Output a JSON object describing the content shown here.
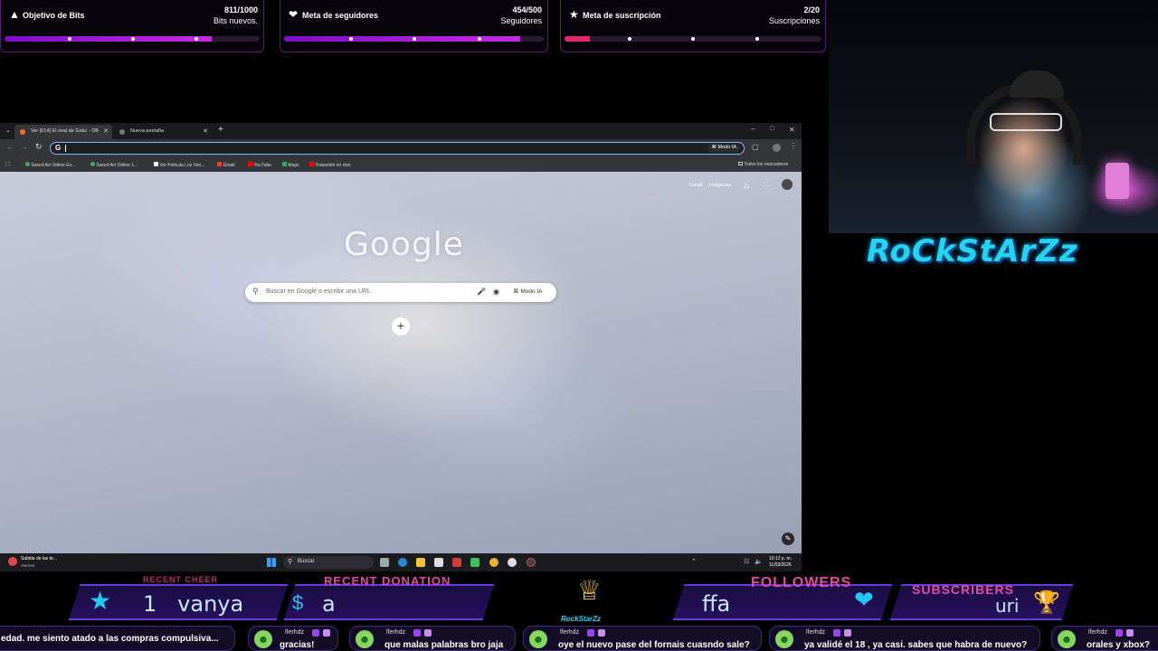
{
  "goals": {
    "bits": {
      "title": "Objetivo de Bits",
      "count": "811/1000",
      "sub": "Bits nuevos.",
      "icon": "bits-icon",
      "progress": 0.811
    },
    "followers": {
      "title": "Meta de seguidores",
      "count": "454/500",
      "sub": "Seguidores",
      "icon": "heart-icon",
      "progress": 0.908
    },
    "subs": {
      "title": "Meta de suscripción",
      "count": "2/20",
      "sub": "Suscripciones",
      "icon": "star-icon",
      "progress": 0.1
    }
  },
  "browser": {
    "tabs": [
      {
        "label": "Ver [014] El rival de Goku - DB",
        "active": true
      },
      {
        "label": "Nueva pestaña",
        "active": false
      }
    ],
    "omnibox_mode": "Modo IA",
    "bookmarks": [
      "Sword Art Online Ex...",
      "Sword Art Online 1...",
      "Ver Pelicula Los Ven...",
      "Gmail",
      "YouTube",
      "Maps",
      "Transmitir en vivo"
    ],
    "all_bookmarks": "Todos los marcadores",
    "top_links": {
      "gmail": "Gmail",
      "images": "Imágenes"
    },
    "logo": "Google",
    "search_placeholder": "Buscar en Google o escribir una URL",
    "search_mode": "Modo IA"
  },
  "taskbar": {
    "weather_title": "Subida de las te...",
    "weather_sub": "Viernes",
    "search": "Buscar",
    "time": "10:12 p. m.",
    "date": "11/03/2026"
  },
  "brand": "RoCkStArZz",
  "overlay": {
    "recent_cheer_label": "RECENT CHEER",
    "recent_cheer_value": "1   vanya",
    "recent_donation_label": "RECENT DONATION",
    "recent_donation_value": "a",
    "followers_label": "FOLLOWERS",
    "followers_value": "ffa",
    "subscribers_label": "SUBSCRIBERS",
    "subscribers_value": "uri",
    "logo_text": "RockStarZz"
  },
  "chat": [
    {
      "user": "",
      "msg": "edad. me siento atado a las compras compulsiva..."
    },
    {
      "user": "lferhdz",
      "msg": "gracias!"
    },
    {
      "user": "lferhdz",
      "msg": "que malas palabras bro jaja"
    },
    {
      "user": "lferhdz",
      "msg": "oye el nuevo pase del fornais cuasndo sale?"
    },
    {
      "user": "lferhdz",
      "msg": "ya validé el 18 , ya casi. sabes que habra de nuevo?"
    },
    {
      "user": "lferhdz",
      "msg": "orales y xbox?"
    }
  ]
}
